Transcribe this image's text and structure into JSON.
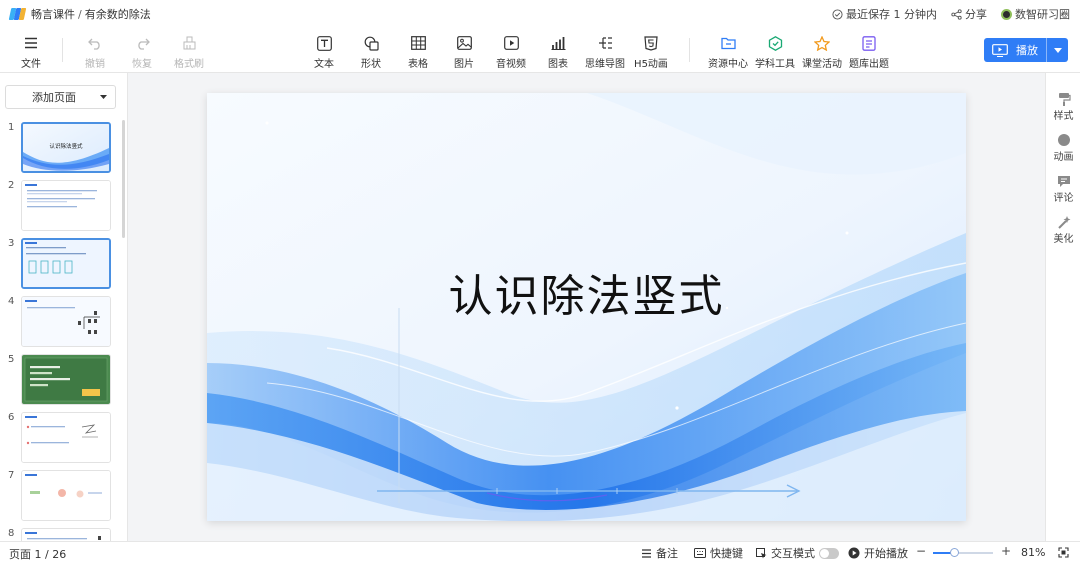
{
  "app": {
    "name": "畅言课件",
    "doc_title": "有余数的除法",
    "separator": "/"
  },
  "titlebar": {
    "save_status": "最近保存 1 分钟内",
    "share_label": "分享",
    "workspace_label": "数智研习圈"
  },
  "toolbar": {
    "file": "文件",
    "undo": "撤销",
    "redo": "恢复",
    "format_painter": "格式刷",
    "text": "文本",
    "shape": "形状",
    "table": "表格",
    "image": "图片",
    "media": "音视频",
    "chart": "图表",
    "mindmap": "思维导图",
    "h5": "H5动画",
    "resource_center": "资源中心",
    "subject_tools": "学科工具",
    "class_activity": "课堂活动",
    "question_bank": "题库出题",
    "play": "播放"
  },
  "sidebar": {
    "add_page": "添加页面",
    "thumbnails": [
      {
        "num": "1",
        "title": "认识除法竖式"
      },
      {
        "num": "2",
        "title": ""
      },
      {
        "num": "3",
        "title": ""
      },
      {
        "num": "4",
        "title": ""
      },
      {
        "num": "5",
        "title": ""
      },
      {
        "num": "6",
        "title": ""
      },
      {
        "num": "7",
        "title": ""
      },
      {
        "num": "8",
        "title": ""
      }
    ],
    "active_index": 3
  },
  "slide": {
    "title": "认识除法竖式"
  },
  "rightpanel": {
    "style": "样式",
    "animation": "动画",
    "comment": "评论",
    "beautify": "美化"
  },
  "statusbar": {
    "page_label": "页面 1 / 26",
    "notes": "备注",
    "shortcuts": "快捷键",
    "interactive_mode": "交互模式",
    "start_play": "开始播放",
    "zoom": "81%",
    "zoom_fraction": 0.35
  },
  "colors": {
    "accent": "#2f7df6",
    "active_thumb_border": "#4a90e2"
  }
}
